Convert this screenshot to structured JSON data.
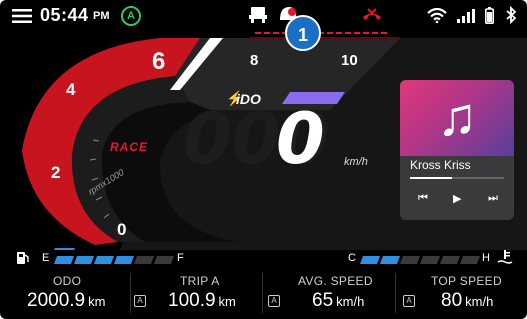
{
  "status_bar": {
    "time": "05:44",
    "ampm": "PM",
    "mode_badge": "A",
    "icons": [
      "menu-icon",
      "vehicle-icon",
      "helmet-icon",
      "call-end-icon",
      "wifi-icon",
      "signal-icon",
      "battery-icon",
      "bluetooth-icon"
    ]
  },
  "gauge": {
    "rpm_labels": [
      "0",
      "2",
      "4",
      "6",
      "8",
      "10"
    ],
    "ride_mode": "RACE",
    "rpm_unit": "rpmx1000",
    "gear_indicator": "iDO",
    "speed": "0",
    "speed_ghost": "000",
    "speed_unit": "km/h",
    "colors": {
      "redline": "#e8162a",
      "accent": "#8a6cf0",
      "gauge_blue": "#2f6fd6"
    }
  },
  "callout": {
    "number": "1"
  },
  "media": {
    "track": "Kross Kriss",
    "progress": 0.45,
    "controls": [
      "previous-icon",
      "play-icon",
      "next-icon"
    ]
  },
  "fuel": {
    "empty": "E",
    "full": "F",
    "filled_segments": 4,
    "total_segments": 6
  },
  "temp": {
    "cold": "C",
    "hot": "H",
    "filled_segments": 2,
    "total_segments": 6
  },
  "trip_info": [
    {
      "label": "ODO",
      "value": "2000.9",
      "unit": "km",
      "badge": "A"
    },
    {
      "label": "TRIP A",
      "value": "100.9",
      "unit": "km",
      "badge": "A"
    },
    {
      "label": "AVG. SPEED",
      "value": "65",
      "unit": "km/h",
      "badge": "A"
    },
    {
      "label": "TOP SPEED",
      "value": "80",
      "unit": "km/h"
    }
  ]
}
